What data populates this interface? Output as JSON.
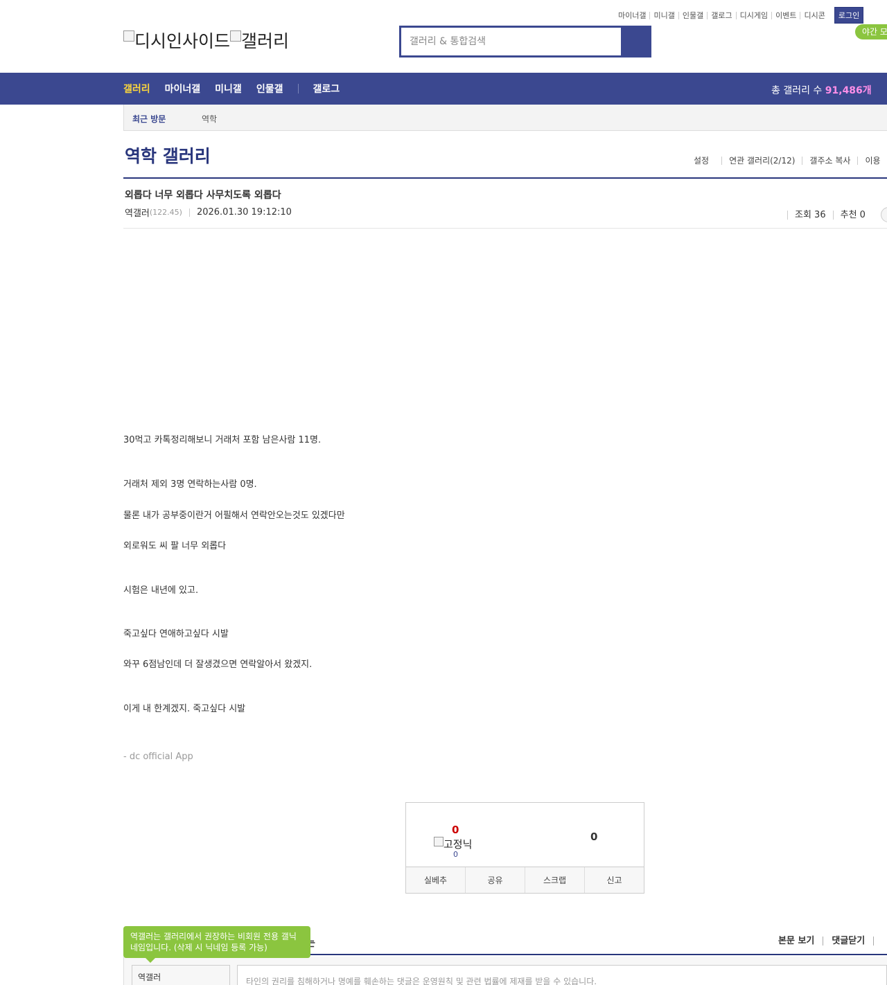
{
  "util_links": [
    "마이너갤",
    "미니갤",
    "인물갤",
    "갤로그",
    "디시게임",
    "이벤트",
    "디시콘"
  ],
  "login_label": "로그인",
  "night_mode_label": "야간 모드",
  "logo": {
    "brand": "디시인사이드",
    "section": "갤러리"
  },
  "search": {
    "placeholder": "갤러리 & 통합검색"
  },
  "nav": {
    "items": [
      "갤러리",
      "마이너갤",
      "미니갤",
      "인물갤"
    ],
    "gallog": "갤로그",
    "total_label": "총 갤러리 수 ",
    "total_count": "91,486개"
  },
  "recent": {
    "title": "최근 방문",
    "item": "역학"
  },
  "gallery": {
    "title": "역학 갤러리",
    "menu": [
      "설정",
      "연관 갤러리(2/12)",
      "갤주소 복사",
      "이용"
    ]
  },
  "post": {
    "title": "외롭다 너무 외롭다 사무치도록 외롭다",
    "author": "역갤러",
    "ip": "(122.45)",
    "date": "2026.01.30 19:12:10",
    "views": "조회 36",
    "recommend": "추천 0",
    "body": [
      "30먹고 카톡정리해보니 거래처 포함 남은사람 11명.",
      "거래처 제외 3명 연락하는사람 0명.",
      "물론 내가 공부중이란거 어필해서 연락안오는것도 있겠다만",
      "외로워도 씨 팔 너무 외롭다",
      "시험은 내년에 있고.",
      "죽고싶다 연애하고싶다 시발",
      "와꾸 6점남인데 더 잘생겼으면 연락알아서 왔겠지.",
      "이게 내 한계겠지. 죽고싶다 시발"
    ],
    "signature": "- dc official App"
  },
  "recommend_box": {
    "up_count": "0",
    "fixed_nick_label": "고정닉",
    "fixed_nick_count": "0",
    "down_count": "0",
    "buttons": [
      "실베추",
      "공유",
      "스크랩",
      "신고"
    ]
  },
  "comment": {
    "tip": "역갤러는 갤러리에서 권장하는 비회원 전용 갤닉네임입니다. (삭제 시 닉네임 등록 가능)",
    "hidden_title_tail": "는",
    "view_body": "본문 보기",
    "close_comments": "댓글닫기",
    "nickname": "역갤러",
    "placeholder": "타인의 권리를 침해하거나 명예를 훼손하는 댓글은 운영원칙 및 관련 법률에 제재를 받을 수 있습니다."
  },
  "colors": {
    "brand": "#3b4890",
    "brand_dark": "#29367c",
    "active_nav": "#ffd83b",
    "count_pink": "#ff8fe8",
    "green": "#8bc53f"
  }
}
